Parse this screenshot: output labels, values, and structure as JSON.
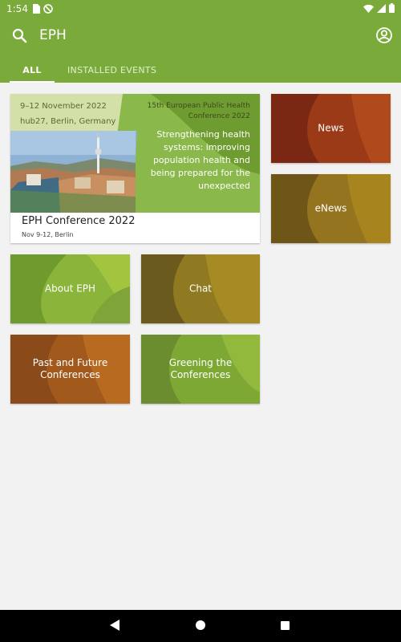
{
  "status_bar": {
    "time": "1:54"
  },
  "app_bar": {
    "search_text": "EPH",
    "tabs": [
      {
        "label": "ALL"
      },
      {
        "label": "INSTALLED EVENTS"
      }
    ]
  },
  "conference": {
    "banner_date": "9–12 November 2022",
    "banner_place": "hub27, Berlin, Germany",
    "banner_conference": "15th European Public Health Conference 2022",
    "banner_tagline": "Strengthening health systems: improving population health and being prepared for the unexpected",
    "title": "EPH Conference 2022",
    "subtitle": "Nov 9-12, Berlin"
  },
  "tiles": [
    {
      "label": "About EPH"
    },
    {
      "label": "Chat"
    },
    {
      "label": "Past and Future Conferences"
    },
    {
      "label": "Greening the Conferences"
    },
    {
      "label": "News"
    },
    {
      "label": "eNews"
    }
  ],
  "colors": {
    "primary": "#7aab3a",
    "background": "#f2f2f2"
  }
}
